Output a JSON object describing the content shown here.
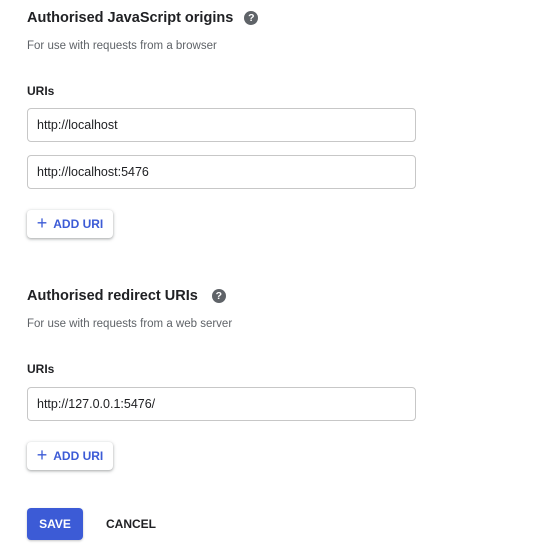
{
  "js_origins": {
    "heading": "Authorised JavaScript origins",
    "help_icon": "help-circle-icon",
    "help_glyph": "?",
    "description": "For use with requests from a browser",
    "uris_label": "URIs",
    "uris": [
      "http://localhost",
      "http://localhost:5476"
    ],
    "add_uri_label": "ADD URI",
    "add_icon": "plus-icon",
    "add_glyph": "+"
  },
  "redirect_uris": {
    "heading": "Authorised redirect URIs",
    "help_icon": "help-circle-icon",
    "help_glyph": "?",
    "description": "For use with requests from a web server",
    "uris_label": "URIs",
    "uris": [
      "http://127.0.0.1:5476/"
    ],
    "add_uri_label": "ADD URI",
    "add_icon": "plus-icon",
    "add_glyph": "+"
  },
  "actions": {
    "save_label": "SAVE",
    "cancel_label": "CANCEL"
  },
  "colors": {
    "accent": "#3c5bd6",
    "text": "#202124",
    "secondary_text": "#5f6368",
    "border": "#c7c7c7"
  }
}
